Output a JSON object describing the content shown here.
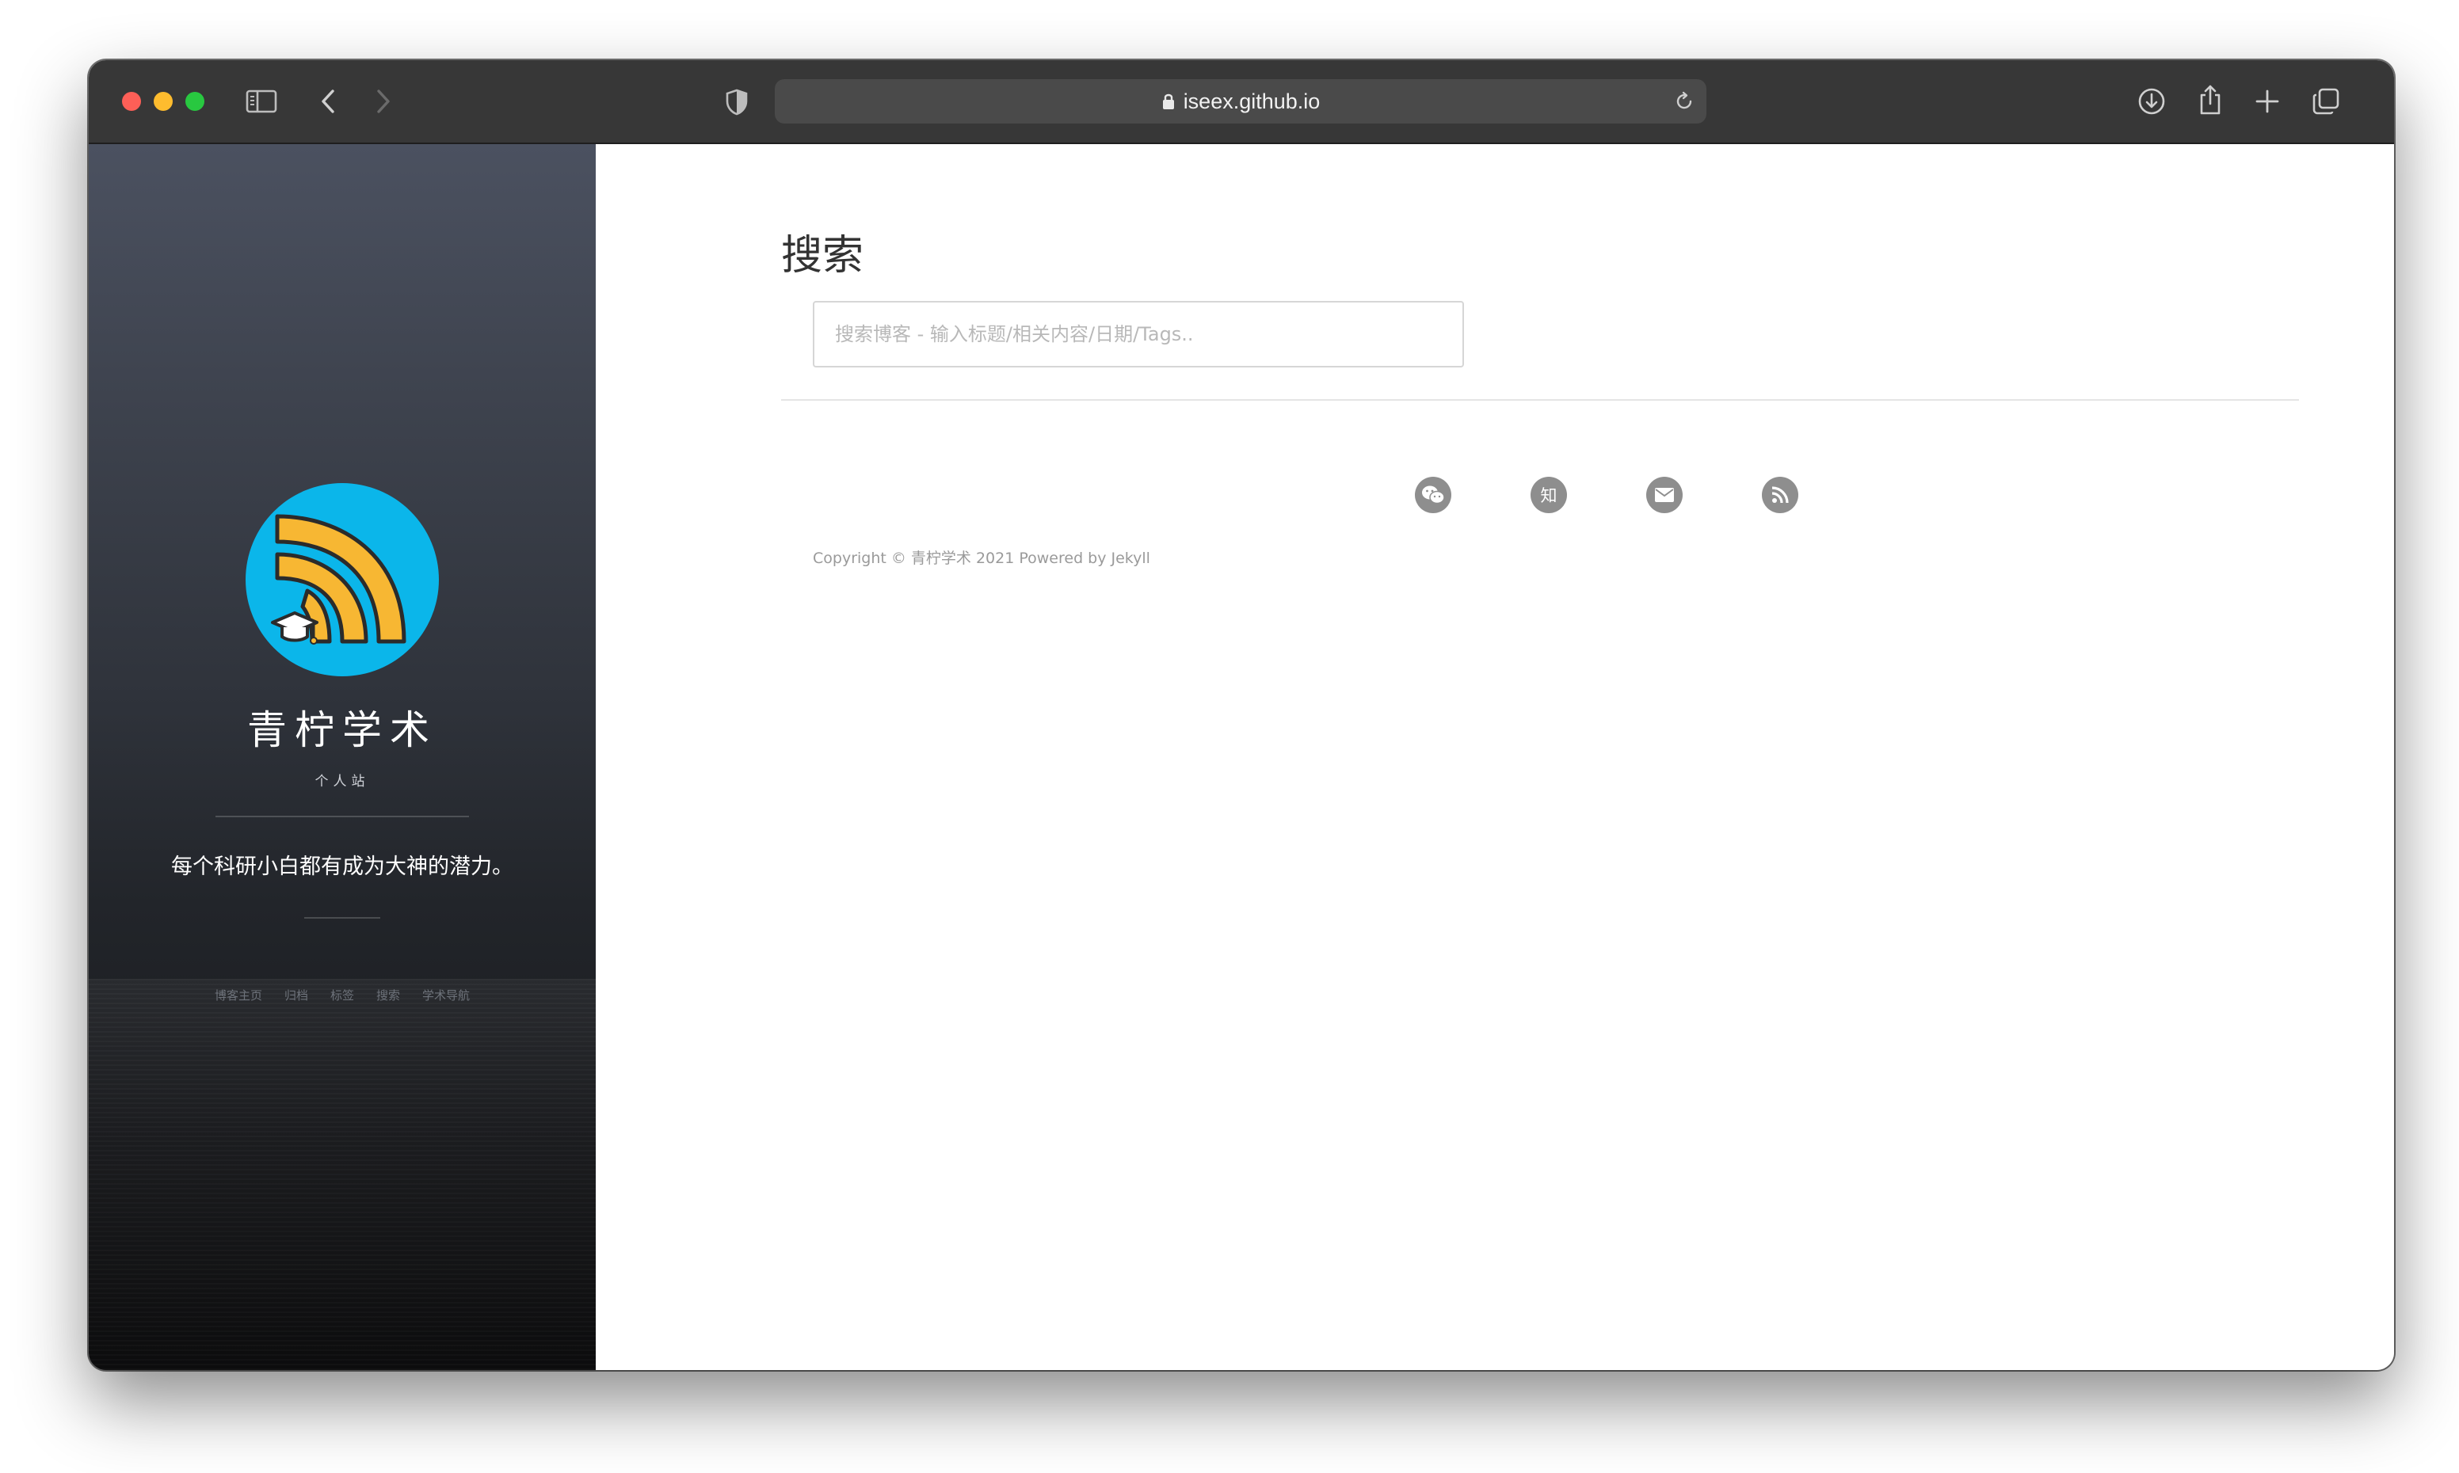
{
  "browser": {
    "url": "iseex.github.io"
  },
  "sidebar": {
    "site_title": "青柠学术",
    "site_subtitle": "个人站",
    "motto": "每个科研小白都有成为大神的潜力。",
    "nav": [
      {
        "label": "博客主页"
      },
      {
        "label": "归档"
      },
      {
        "label": "标签"
      },
      {
        "label": "搜索"
      },
      {
        "label": "学术导航"
      }
    ]
  },
  "main": {
    "title": "搜索",
    "search_placeholder": "搜索博客 - 输入标题/相关内容/日期/Tags..",
    "search_value": "",
    "social": [
      {
        "icon": "wechat-icon"
      },
      {
        "icon": "zhihu-icon",
        "glyph": "知"
      },
      {
        "icon": "email-icon"
      },
      {
        "icon": "rss-icon"
      }
    ],
    "copyright": "Copyright © 青柠学术 2021 Powered by Jekyll"
  },
  "colors": {
    "titlebar": "#373737",
    "avatar_bg": "#0bb6ea",
    "avatar_feed": "#f7b733",
    "social_icon_bg": "#8e8e8e"
  }
}
